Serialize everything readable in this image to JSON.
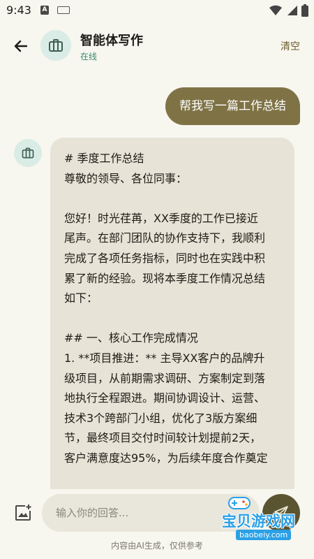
{
  "status_bar": {
    "time": "9:43",
    "notif_icon_letter": "A"
  },
  "header": {
    "title": "智能体写作",
    "status": "在线",
    "clear_label": "清空"
  },
  "messages": {
    "user": "帮我写一篇工作总结",
    "bot_lines": [
      "# 季度工作总结",
      "尊敬的领导、各位同事：",
      "",
      "您好！时光荏苒，XX季度的工作已接近",
      "尾声。在部门团队的协作支持下，我顺利",
      "完成了各项任务指标，同时也在实践中积",
      "累了新的经验。现将本季度工作情况总结",
      "如下：",
      "",
      "## 一、核心工作完成情况",
      "1. **项目推进：** 主导XX客户的品牌升",
      "级项目，从前期需求调研、方案制定到落",
      "地执行全程跟进。期间协调设计、运营、",
      "技术3个跨部门小组，优化了3版方案细",
      "节，最终项目交付时间较计划提前2天，",
      "客户满意度达95%，为后续年度合作奠定"
    ]
  },
  "input": {
    "placeholder": "输入你的回答...",
    "disclaimer": "内容由AI生成，仅供参考"
  },
  "watermark": {
    "text": "宝贝游戏网",
    "url": "baobeiy.com"
  },
  "colors": {
    "accent": "#7f7346",
    "send_button": "#5b5431",
    "online": "#3a8a68",
    "bot_bubble": "#e7e3d6",
    "avatar_bg": "#d9ece5"
  },
  "icons": {
    "back": "arrow-left-icon",
    "avatar": "briefcase-icon",
    "add_image": "add-photo-icon",
    "send": "send-icon"
  }
}
